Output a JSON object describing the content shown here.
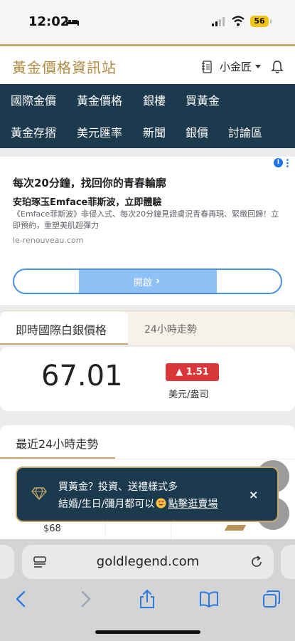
{
  "status_bar": {
    "time": "12:02",
    "battery": "56"
  },
  "header": {
    "site_title": "黃金價格資訊站",
    "user_name": "小金匠"
  },
  "nav": {
    "row1": [
      "國際金價",
      "黃金價格",
      "銀樓",
      "買黃金"
    ],
    "row2": [
      "黃金存摺",
      "美元匯率",
      "新聞",
      "銀價",
      "討論區"
    ]
  },
  "ad": {
    "info": "i",
    "title": "每次20分鐘，找回你的青春輪廓",
    "subtitle": "安珀琢玉Emface菲斯波，立即體驗",
    "description": "《Emface菲斯波》非侵入式、每次20分鐘見證膚況青春再現、緊緻回歸！立即預約，重塑美肌超彈力",
    "domain": "le-renouveau.com",
    "button_label": "開啟",
    "button_arrow": "›"
  },
  "price_tabs": {
    "live_label": "即時國際白銀價格",
    "trend_label": "24小時走勢"
  },
  "price": {
    "value": "67.01",
    "change": "▲ 1.51",
    "unit": "美元/盎司"
  },
  "trend": {
    "title": "最近24小時走勢",
    "y_label": "$68"
  },
  "promo": {
    "line1": "買黃金？投資、送禮樣式多",
    "line2_prefix": "結婚/生日/彌月都可以",
    "link": "點擊逛賣場",
    "close": "×"
  },
  "browser": {
    "url": "goldlegend.com"
  },
  "colors": {
    "gold": "#c9a96b",
    "navy": "#1c3a4e",
    "up_red": "#d9383a",
    "link_blue": "#1a73e8"
  }
}
